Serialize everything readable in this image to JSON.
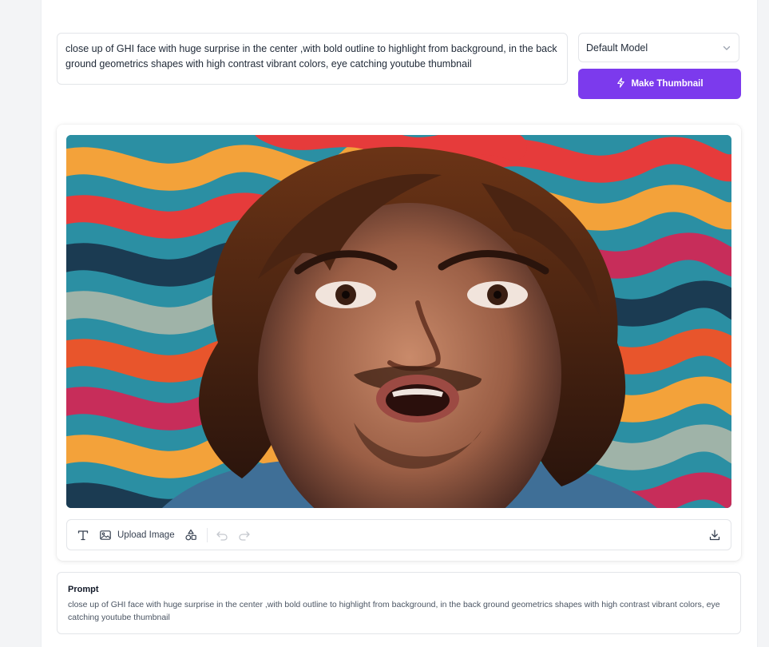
{
  "prompt_input": {
    "value": "close up of GHI face with huge surprise in the center ,with bold outline to highlight from background, in the back ground geometrics shapes with high contrast vibrant colors, eye catching youtube thumbnail"
  },
  "model_select": {
    "selected": "Default Model",
    "icon": "chevron-down-icon"
  },
  "make_button": {
    "label": "Make Thumbnail",
    "icon": "lightning-icon",
    "color": "#7c3aed"
  },
  "thumbnail": {
    "description_icon": "generated-image"
  },
  "toolbar": {
    "text_tool_icon": "text-icon",
    "image_icon": "image-icon",
    "upload_label": "Upload Image",
    "shapes_icon": "shapes-icon",
    "undo_icon": "undo-icon",
    "redo_icon": "redo-icon",
    "download_icon": "download-icon"
  },
  "prompt_card": {
    "title": "Prompt",
    "text": "close up of GHI face with huge surprise in the center ,with bold outline to highlight from background, in the back ground geometrics shapes with high contrast vibrant colors, eye catching youtube thumbnail"
  }
}
